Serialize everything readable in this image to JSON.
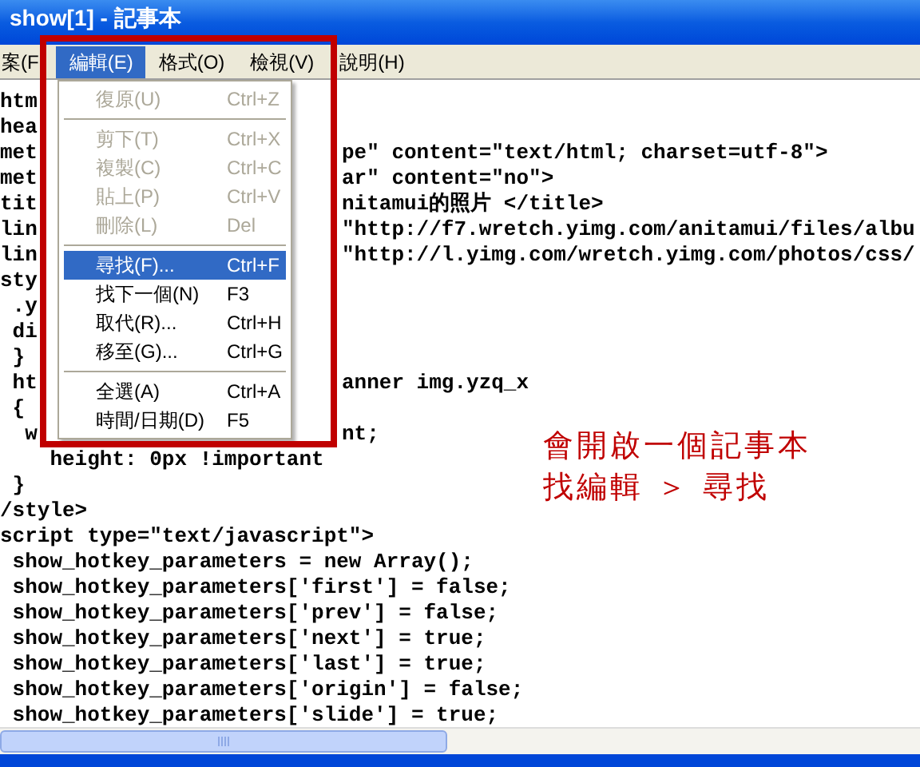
{
  "window": {
    "title": "show[1] - 記事本"
  },
  "menu_bar": [
    {
      "label": "案(F",
      "selected": false
    },
    {
      "label": "編輯(E)",
      "selected": true
    },
    {
      "label": "格式(O)",
      "selected": false
    },
    {
      "label": "檢視(V)",
      "selected": false
    },
    {
      "label": "說明(H)",
      "selected": false
    }
  ],
  "edit_menu": [
    {
      "kind": "item",
      "label": "復原(U)",
      "shortcut": "Ctrl+Z",
      "disabled": true,
      "selected": false
    },
    {
      "kind": "separator"
    },
    {
      "kind": "item",
      "label": "剪下(T)",
      "shortcut": "Ctrl+X",
      "disabled": true,
      "selected": false
    },
    {
      "kind": "item",
      "label": "複製(C)",
      "shortcut": "Ctrl+C",
      "disabled": true,
      "selected": false
    },
    {
      "kind": "item",
      "label": "貼上(P)",
      "shortcut": "Ctrl+V",
      "disabled": true,
      "selected": false
    },
    {
      "kind": "item",
      "label": "刪除(L)",
      "shortcut": "Del",
      "disabled": true,
      "selected": false
    },
    {
      "kind": "separator"
    },
    {
      "kind": "item",
      "label": "尋找(F)...",
      "shortcut": "Ctrl+F",
      "disabled": false,
      "selected": true
    },
    {
      "kind": "item",
      "label": "找下一個(N)",
      "shortcut": "F3",
      "disabled": false,
      "selected": false
    },
    {
      "kind": "item",
      "label": "取代(R)...",
      "shortcut": "Ctrl+H",
      "disabled": false,
      "selected": false
    },
    {
      "kind": "item",
      "label": "移至(G)...",
      "shortcut": "Ctrl+G",
      "disabled": false,
      "selected": false
    },
    {
      "kind": "separator"
    },
    {
      "kind": "item",
      "label": "全選(A)",
      "shortcut": "Ctrl+A",
      "disabled": false,
      "selected": false
    },
    {
      "kind": "item",
      "label": "時間/日期(D)",
      "shortcut": "F5",
      "disabled": false,
      "selected": false
    }
  ],
  "code_lines": [
    {
      "left": "htm"
    },
    {
      "left": "hea"
    },
    {
      "left": "met",
      "right": "pe\" content=\"text/html; charset=utf-8\">"
    },
    {
      "left": "met",
      "right": "ar\" content=\"no\">"
    },
    {
      "left": "tit",
      "right": "nitamui的照片 </title>"
    },
    {
      "left": "lin",
      "right": "\"http://f7.wretch.yimg.com/anitamui/files/albu"
    },
    {
      "left": "lin",
      "right": "\"http://l.yimg.com/wretch.yimg.com/photos/css/"
    },
    {
      "left": "sty"
    },
    {
      "left": " .y"
    },
    {
      "left": " di"
    },
    {
      "left": " }"
    },
    {
      "left": " ht",
      "right": "anner img.yzq_x"
    },
    {
      "left": " {"
    },
    {
      "left": "  w",
      "right": "nt;"
    },
    {
      "left": "    height: 0px !important"
    },
    {
      "left": " }"
    },
    {
      "left": "/style>"
    },
    {
      "left": "script type=\"text/javascript\">"
    },
    {
      "left": " show_hotkey_parameters = new Array();"
    },
    {
      "left": " show_hotkey_parameters['first'] = false;"
    },
    {
      "left": " show_hotkey_parameters['prev'] = false;"
    },
    {
      "left": " show_hotkey_parameters['next'] = true;"
    },
    {
      "left": " show_hotkey_parameters['last'] = true;"
    },
    {
      "left": " show_hotkey_parameters['origin'] = false;"
    },
    {
      "left": " show_hotkey_parameters['slide'] = true;"
    }
  ],
  "annotation": [
    "會開啟一個記事本",
    "找編輯 ＞ 尋找"
  ]
}
